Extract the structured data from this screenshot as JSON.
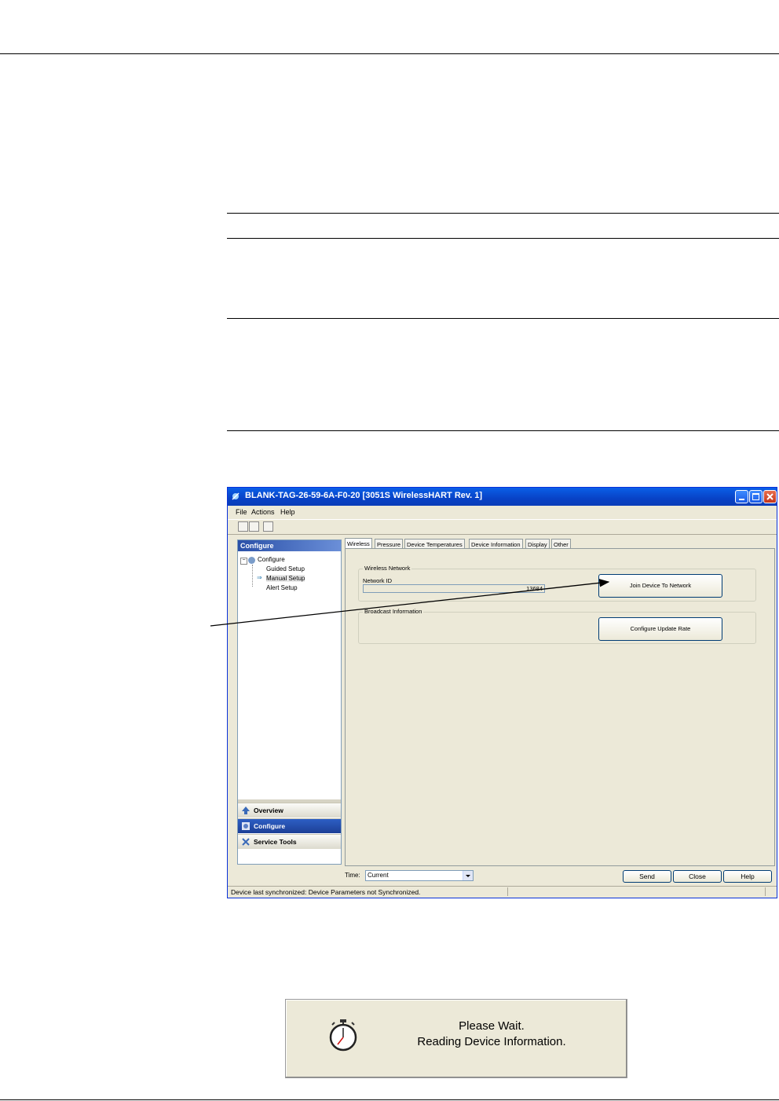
{
  "window": {
    "title": "BLANK-TAG-26-59-6A-F0-20 [3051S WirelessHART Rev. 1]",
    "menu": [
      "File",
      "Actions",
      "Help"
    ]
  },
  "left_panel": {
    "header": "Configure",
    "tree": {
      "root": "Configure",
      "children": [
        "Guided Setup",
        "Manual Setup",
        "Alert Setup"
      ]
    },
    "nav": [
      "Overview",
      "Configure",
      "Service Tools"
    ]
  },
  "tabs": [
    "Wireless",
    "Pressure",
    "Device Temperatures",
    "Device Information",
    "Display",
    "Other"
  ],
  "wireless_network": {
    "group_label": "Wireless Network",
    "network_id_label": "Network ID",
    "network_id_value": "13684",
    "join_button": "Join Device To Network"
  },
  "broadcast": {
    "group_label": "Broadcast Information",
    "update_rate_button": "Configure Update Rate"
  },
  "footer": {
    "time_label": "Time:",
    "time_value": "Current",
    "send": "Send",
    "close": "Close",
    "help": "Help"
  },
  "status": "Device last synchronized: Device Parameters not Synchronized.",
  "wait_dialog": {
    "line1": "Please Wait.",
    "line2": "Reading Device Information."
  },
  "colors": {
    "titlebar": "#0a5fe7",
    "window_bg": "#ece9d8",
    "nav_active": "#2d5fc4"
  }
}
